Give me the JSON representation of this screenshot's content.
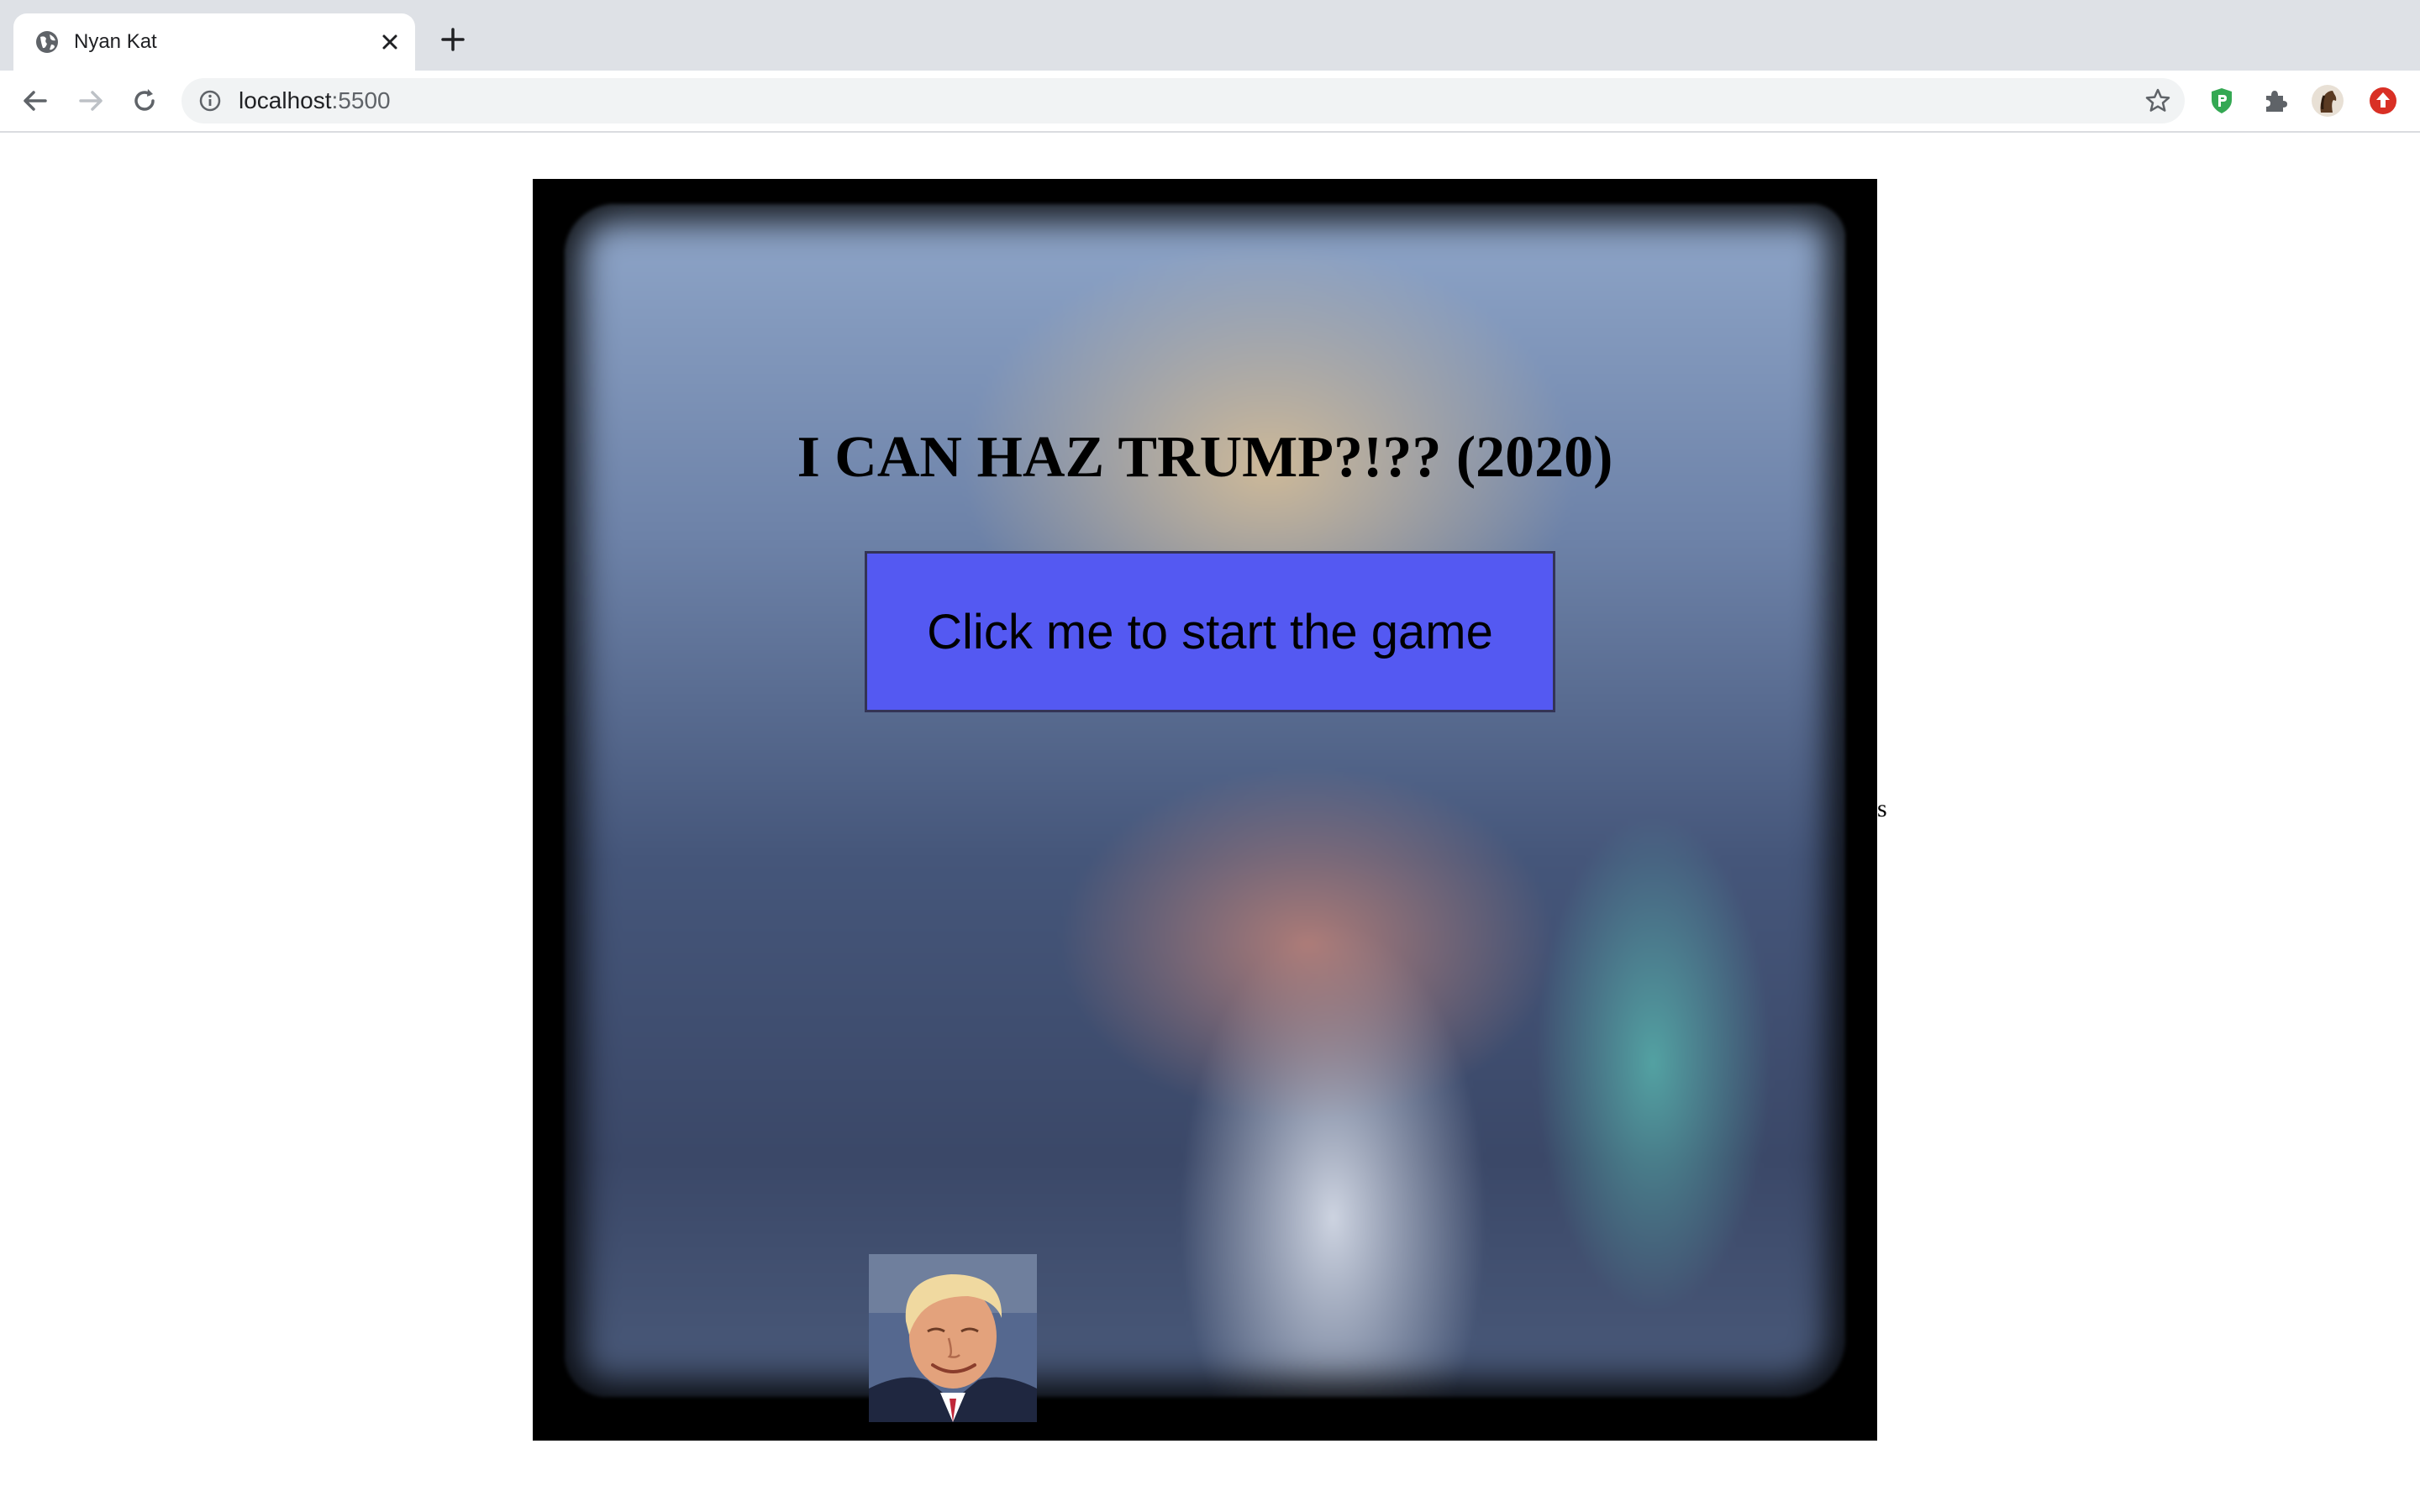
{
  "browser": {
    "tab": {
      "title": "Nyan Kat"
    },
    "omnibox": {
      "host": "localhost",
      "port": ":5500"
    }
  },
  "game": {
    "title": "I CAN HAZ TRUMP?!?? (2020)",
    "start_button_label": "Click me to start the game",
    "stray_text": "s"
  },
  "colors": {
    "start_button": "#5459f2",
    "frame": "#000000"
  }
}
